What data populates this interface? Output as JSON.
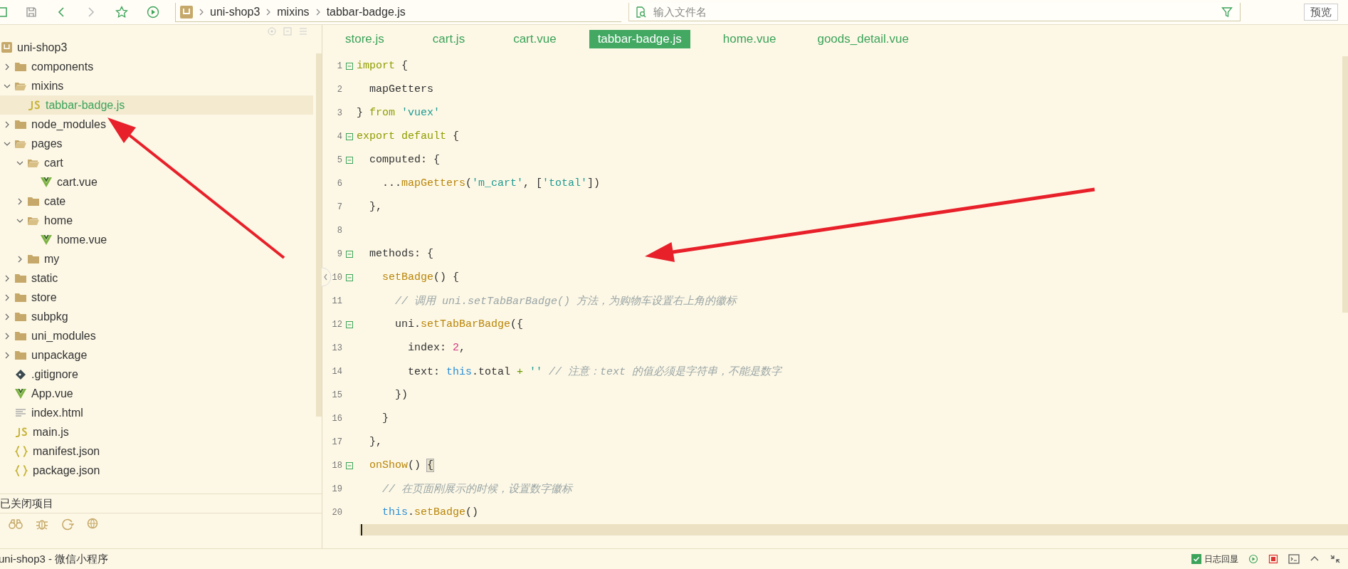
{
  "toolbar": {
    "breadcrumb": [
      "uni-shop3",
      "mixins",
      "tabbar-badge.js"
    ],
    "search": {
      "placeholder": "输入文件名"
    },
    "preview_button": "预览"
  },
  "sidebar": {
    "tree": [
      {
        "label": "uni-shop3",
        "kind": "project",
        "selected": false,
        "children": [
          {
            "label": "components",
            "kind": "folder",
            "expanded": false,
            "selected": false
          },
          {
            "label": "mixins",
            "kind": "folder",
            "expanded": true,
            "selected": false,
            "children": [
              {
                "label": "tabbar-badge.js",
                "kind": "js",
                "selected": true
              }
            ]
          },
          {
            "label": "node_modules",
            "kind": "folder",
            "expanded": false,
            "selected": false
          },
          {
            "label": "pages",
            "kind": "folder",
            "expanded": true,
            "selected": false,
            "children": [
              {
                "label": "cart",
                "kind": "folder",
                "expanded": true,
                "selected": false,
                "children": [
                  {
                    "label": "cart.vue",
                    "kind": "vue",
                    "selected": false
                  }
                ]
              },
              {
                "label": "cate",
                "kind": "folder",
                "expanded": false,
                "selected": false
              },
              {
                "label": "home",
                "kind": "folder",
                "expanded": true,
                "selected": false,
                "children": [
                  {
                    "label": "home.vue",
                    "kind": "vue",
                    "selected": false
                  }
                ]
              },
              {
                "label": "my",
                "kind": "folder",
                "expanded": false,
                "selected": false
              }
            ]
          },
          {
            "label": "static",
            "kind": "folder",
            "expanded": false,
            "selected": false
          },
          {
            "label": "store",
            "kind": "folder",
            "expanded": false,
            "selected": false
          },
          {
            "label": "subpkg",
            "kind": "folder",
            "expanded": false,
            "selected": false
          },
          {
            "label": "uni_modules",
            "kind": "folder",
            "expanded": false,
            "selected": false
          },
          {
            "label": "unpackage",
            "kind": "folder",
            "expanded": false,
            "selected": false
          },
          {
            "label": ".gitignore",
            "kind": "git",
            "selected": false
          },
          {
            "label": "App.vue",
            "kind": "vue",
            "selected": false
          },
          {
            "label": "index.html",
            "kind": "html",
            "selected": false
          },
          {
            "label": "main.js",
            "kind": "js",
            "selected": false
          },
          {
            "label": "manifest.json",
            "kind": "json",
            "selected": false
          },
          {
            "label": "package.json",
            "kind": "json",
            "selected": false
          }
        ]
      }
    ],
    "closed_projects": "已关闭项目"
  },
  "tabs": [
    {
      "label": "store.js",
      "selected": false
    },
    {
      "label": "cart.js",
      "selected": false
    },
    {
      "label": "cart.vue",
      "selected": false
    },
    {
      "label": "tabbar-badge.js",
      "selected": true
    },
    {
      "label": "home.vue",
      "selected": false
    },
    {
      "label": "goods_detail.vue",
      "selected": false
    }
  ],
  "editor": {
    "lines": [
      {
        "number": "1",
        "fold": true,
        "tokens": [
          {
            "kind": "kw",
            "text": "import"
          },
          {
            "kind": "plain",
            "text": " {"
          }
        ]
      },
      {
        "number": "2",
        "fold": false,
        "tokens": [
          {
            "kind": "plain",
            "text": "  mapGetters"
          }
        ]
      },
      {
        "number": "3",
        "fold": false,
        "tokens": [
          {
            "kind": "plain",
            "text": "} "
          },
          {
            "kind": "kw",
            "text": "from"
          },
          {
            "kind": "str",
            "text": " 'vuex'"
          }
        ]
      },
      {
        "number": "4",
        "fold": true,
        "tokens": [
          {
            "kind": "kw",
            "text": "export default"
          },
          {
            "kind": "plain",
            "text": " {"
          }
        ]
      },
      {
        "number": "5",
        "fold": true,
        "tokens": [
          {
            "kind": "plain",
            "text": "  computed: {"
          }
        ]
      },
      {
        "number": "6",
        "fold": false,
        "tokens": [
          {
            "kind": "plain",
            "text": "    ..."
          },
          {
            "kind": "fn",
            "text": "mapGetters"
          },
          {
            "kind": "plain",
            "text": "("
          },
          {
            "kind": "str",
            "text": "'m_cart'"
          },
          {
            "kind": "plain",
            "text": ", ["
          },
          {
            "kind": "str",
            "text": "'total'"
          },
          {
            "kind": "plain",
            "text": "])"
          }
        ]
      },
      {
        "number": "7",
        "fold": false,
        "tokens": [
          {
            "kind": "plain",
            "text": "  },"
          }
        ]
      },
      {
        "number": "8",
        "fold": false
      },
      {
        "number": "9",
        "fold": true,
        "tokens": [
          {
            "kind": "plain",
            "text": "  methods: {"
          }
        ]
      },
      {
        "number": "10",
        "fold": true,
        "tokens": [
          {
            "kind": "fn",
            "text": "    setBadge"
          },
          {
            "kind": "plain",
            "text": "() {"
          }
        ]
      },
      {
        "number": "11",
        "fold": false,
        "tokens": [
          {
            "kind": "cmt",
            "text": "      // 调用 uni.setTabBarBadge() 方法，为购物车设置右上角的徽标"
          }
        ]
      },
      {
        "number": "12",
        "fold": true,
        "tokens": [
          {
            "kind": "plain",
            "text": "      uni."
          },
          {
            "kind": "fn",
            "text": "setTabBarBadge"
          },
          {
            "kind": "plain",
            "text": "({"
          }
        ]
      },
      {
        "number": "13",
        "fold": false,
        "tokens": [
          {
            "kind": "plain",
            "text": "        index: "
          },
          {
            "kind": "num",
            "text": "2"
          },
          {
            "kind": "plain",
            "text": ","
          }
        ]
      },
      {
        "number": "14",
        "fold": false,
        "tokens": [
          {
            "kind": "plain",
            "text": "        text: "
          },
          {
            "kind": "this",
            "text": "this"
          },
          {
            "kind": "plain",
            "text": ".total "
          },
          {
            "kind": "op",
            "text": "+"
          },
          {
            "kind": "str",
            "text": " ''"
          },
          {
            "kind": "cmt",
            "text": " // 注意：text 的值必须是字符串，不能是数字"
          }
        ]
      },
      {
        "number": "15",
        "fold": false,
        "tokens": [
          {
            "kind": "plain",
            "text": "      })"
          }
        ]
      },
      {
        "number": "16",
        "fold": false,
        "tokens": [
          {
            "kind": "plain",
            "text": "    }"
          }
        ]
      },
      {
        "number": "17",
        "fold": false,
        "tokens": [
          {
            "kind": "plain",
            "text": "  },"
          }
        ]
      },
      {
        "number": "18",
        "fold": true,
        "tokens": [
          {
            "kind": "fn",
            "text": "  onShow"
          },
          {
            "kind": "plain",
            "text": "() "
          },
          {
            "kind": "bracket",
            "text": "{"
          }
        ]
      },
      {
        "number": "19",
        "fold": false,
        "tokens": [
          {
            "kind": "cmt",
            "text": "    // 在页面刚展示的时候，设置数字徽标"
          }
        ]
      },
      {
        "number": "20",
        "fold": false,
        "tokens": [
          {
            "kind": "this",
            "text": "    this"
          },
          {
            "kind": "plain",
            "text": "."
          },
          {
            "kind": "fn",
            "text": "setBadge"
          },
          {
            "kind": "plain",
            "text": "()"
          }
        ]
      }
    ]
  },
  "status_bar": {
    "project": "uni-shop3 - 微信小程序",
    "log_echo": {
      "label": "日志回显",
      "checked": true
    }
  }
}
